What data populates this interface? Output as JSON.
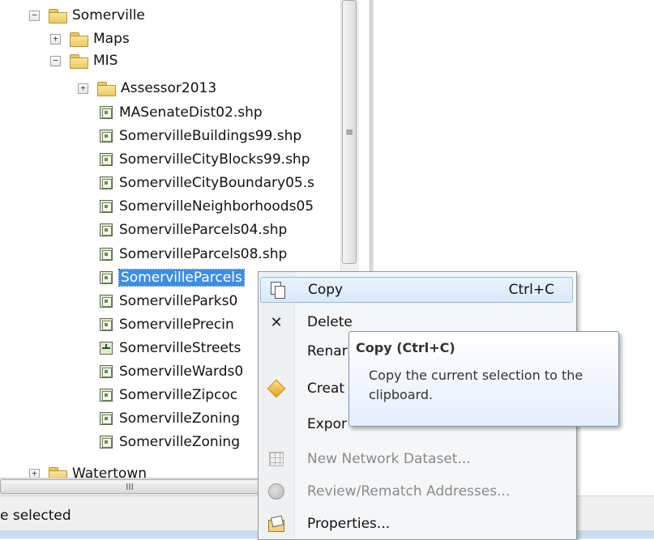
{
  "tree": {
    "somerville": "Somerville",
    "maps": "Maps",
    "mis": "MIS",
    "assessor": "Assessor2013",
    "files": [
      "MASenateDist02.shp",
      "SomervilleBuildings99.shp",
      "SomervilleCityBlocks99.shp",
      "SomervilleCityBoundary05.s",
      "SomervilleNeighborhoods05",
      "SomervilleParcels04.shp",
      "SomervilleParcels08.shp",
      "SomervilleParcels",
      "SomervilleParks0",
      "SomervillePrecin",
      "SomervilleStreets",
      "SomervilleWards0",
      "SomervilleZipcoc",
      "SomervilleZoning",
      "SomervilleZoning"
    ],
    "watertown": "Watertown",
    "expand_plus": "+",
    "expand_minus": "−"
  },
  "scrollbars": {
    "vertical_grip": "≡",
    "horizontal_grip": "III"
  },
  "context_menu": {
    "copy": "Copy",
    "copy_shortcut": "Ctrl+C",
    "delete": "Delete",
    "rename": "Renar",
    "create": "Creat",
    "export": "Expor",
    "new_network_dataset": "New Network Dataset...",
    "review_rematch": "Review/Rematch Addresses...",
    "properties": "Properties..."
  },
  "tooltip": {
    "title": "Copy (Ctrl+C)",
    "body": "Copy the current selection to the clipboard."
  },
  "status": {
    "text": "e selected"
  },
  "colors": {
    "selection": "#3a8ee6",
    "menu_highlight": "#d8e9fb",
    "tooltip_border": "#7a95bd"
  }
}
